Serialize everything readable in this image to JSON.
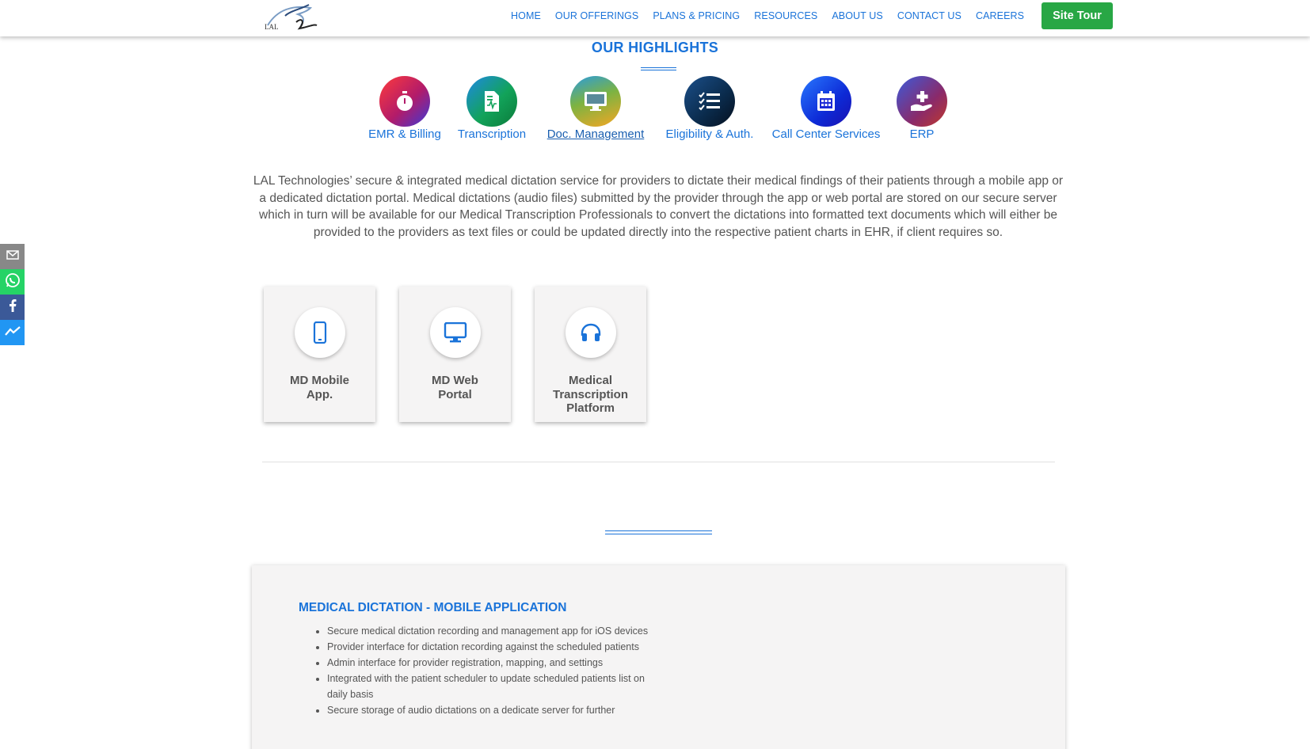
{
  "header": {
    "nav": [
      "HOME",
      "OUR OFFERINGS",
      "PLANS & PRICING",
      "RESOURCES",
      "ABOUT US",
      "CONTACT US",
      "CAREERS"
    ],
    "cta": "Site Tour",
    "logo_text": "LAL"
  },
  "highlights": {
    "title": "OUR HIGHLIGHTS",
    "items": [
      {
        "label": "EMR & Billing",
        "icon": "stopwatch-icon"
      },
      {
        "label": "Transcription",
        "icon": "document-icon"
      },
      {
        "label": "Doc. Management",
        "icon": "monitor-icon",
        "active": true
      },
      {
        "label": "Eligibility & Auth.",
        "icon": "checklist-icon"
      },
      {
        "label": "Call Center Services",
        "icon": "calendar-icon"
      },
      {
        "label": "ERP",
        "icon": "hand-plus-icon"
      }
    ]
  },
  "intro": "LAL Technologies’ secure & integrated medical dictation service for providers to dictate their medical findings of their patients through a mobile app or a dedicated dictation portal. Medical dictations (audio files) submitted by the provider through the app or web portal are stored on our secure server which in turn will be available for our Medical Transcription Professionals to convert the dictations into formatted text documents which will either be provided to the providers as text files or could be updated directly into the respective patient charts in EHR, if client requires so.",
  "cards": [
    {
      "label": "MD Mobile App.",
      "icon": "mobile-icon"
    },
    {
      "label": "MD Web Portal",
      "icon": "desktop-icon"
    },
    {
      "label": "Medical Transcription Platform",
      "icon": "headphones-icon"
    }
  ],
  "panel": {
    "title": "MEDICAL DICTATION - MOBILE APPLICATION",
    "items": [
      "Secure medical dictation recording and management app for iOS devices",
      "Provider interface for dictation recording against the scheduled patients",
      "Admin interface for provider registration, mapping, and settings",
      "Integrated with the patient scheduler to update scheduled patients list on daily basis",
      "Secure storage of audio dictations on a dedicate server for further"
    ]
  },
  "social": [
    "email-icon",
    "whatsapp-icon",
    "facebook-icon",
    "messenger-icon"
  ],
  "colors": {
    "accent": "#1a73d9",
    "cta": "#28a745",
    "card_bg": "#f5f4f4"
  }
}
